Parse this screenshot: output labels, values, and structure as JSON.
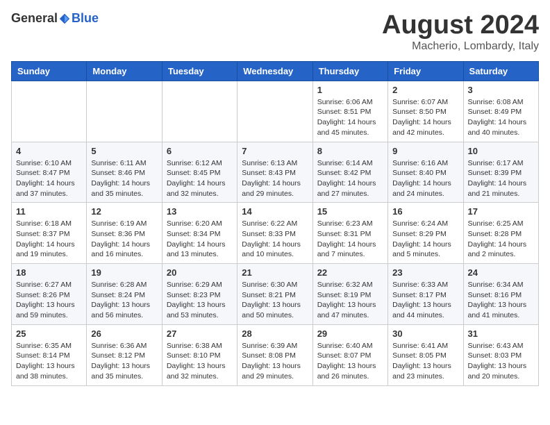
{
  "header": {
    "logo_general": "General",
    "logo_blue": "Blue",
    "month": "August 2024",
    "location": "Macherio, Lombardy, Italy"
  },
  "weekdays": [
    "Sunday",
    "Monday",
    "Tuesday",
    "Wednesday",
    "Thursday",
    "Friday",
    "Saturday"
  ],
  "weeks": [
    [
      {
        "day": "",
        "info": ""
      },
      {
        "day": "",
        "info": ""
      },
      {
        "day": "",
        "info": ""
      },
      {
        "day": "",
        "info": ""
      },
      {
        "day": "1",
        "info": "Sunrise: 6:06 AM\nSunset: 8:51 PM\nDaylight: 14 hours\nand 45 minutes."
      },
      {
        "day": "2",
        "info": "Sunrise: 6:07 AM\nSunset: 8:50 PM\nDaylight: 14 hours\nand 42 minutes."
      },
      {
        "day": "3",
        "info": "Sunrise: 6:08 AM\nSunset: 8:49 PM\nDaylight: 14 hours\nand 40 minutes."
      }
    ],
    [
      {
        "day": "4",
        "info": "Sunrise: 6:10 AM\nSunset: 8:47 PM\nDaylight: 14 hours\nand 37 minutes."
      },
      {
        "day": "5",
        "info": "Sunrise: 6:11 AM\nSunset: 8:46 PM\nDaylight: 14 hours\nand 35 minutes."
      },
      {
        "day": "6",
        "info": "Sunrise: 6:12 AM\nSunset: 8:45 PM\nDaylight: 14 hours\nand 32 minutes."
      },
      {
        "day": "7",
        "info": "Sunrise: 6:13 AM\nSunset: 8:43 PM\nDaylight: 14 hours\nand 29 minutes."
      },
      {
        "day": "8",
        "info": "Sunrise: 6:14 AM\nSunset: 8:42 PM\nDaylight: 14 hours\nand 27 minutes."
      },
      {
        "day": "9",
        "info": "Sunrise: 6:16 AM\nSunset: 8:40 PM\nDaylight: 14 hours\nand 24 minutes."
      },
      {
        "day": "10",
        "info": "Sunrise: 6:17 AM\nSunset: 8:39 PM\nDaylight: 14 hours\nand 21 minutes."
      }
    ],
    [
      {
        "day": "11",
        "info": "Sunrise: 6:18 AM\nSunset: 8:37 PM\nDaylight: 14 hours\nand 19 minutes."
      },
      {
        "day": "12",
        "info": "Sunrise: 6:19 AM\nSunset: 8:36 PM\nDaylight: 14 hours\nand 16 minutes."
      },
      {
        "day": "13",
        "info": "Sunrise: 6:20 AM\nSunset: 8:34 PM\nDaylight: 14 hours\nand 13 minutes."
      },
      {
        "day": "14",
        "info": "Sunrise: 6:22 AM\nSunset: 8:33 PM\nDaylight: 14 hours\nand 10 minutes."
      },
      {
        "day": "15",
        "info": "Sunrise: 6:23 AM\nSunset: 8:31 PM\nDaylight: 14 hours\nand 7 minutes."
      },
      {
        "day": "16",
        "info": "Sunrise: 6:24 AM\nSunset: 8:29 PM\nDaylight: 14 hours\nand 5 minutes."
      },
      {
        "day": "17",
        "info": "Sunrise: 6:25 AM\nSunset: 8:28 PM\nDaylight: 14 hours\nand 2 minutes."
      }
    ],
    [
      {
        "day": "18",
        "info": "Sunrise: 6:27 AM\nSunset: 8:26 PM\nDaylight: 13 hours\nand 59 minutes."
      },
      {
        "day": "19",
        "info": "Sunrise: 6:28 AM\nSunset: 8:24 PM\nDaylight: 13 hours\nand 56 minutes."
      },
      {
        "day": "20",
        "info": "Sunrise: 6:29 AM\nSunset: 8:23 PM\nDaylight: 13 hours\nand 53 minutes."
      },
      {
        "day": "21",
        "info": "Sunrise: 6:30 AM\nSunset: 8:21 PM\nDaylight: 13 hours\nand 50 minutes."
      },
      {
        "day": "22",
        "info": "Sunrise: 6:32 AM\nSunset: 8:19 PM\nDaylight: 13 hours\nand 47 minutes."
      },
      {
        "day": "23",
        "info": "Sunrise: 6:33 AM\nSunset: 8:17 PM\nDaylight: 13 hours\nand 44 minutes."
      },
      {
        "day": "24",
        "info": "Sunrise: 6:34 AM\nSunset: 8:16 PM\nDaylight: 13 hours\nand 41 minutes."
      }
    ],
    [
      {
        "day": "25",
        "info": "Sunrise: 6:35 AM\nSunset: 8:14 PM\nDaylight: 13 hours\nand 38 minutes."
      },
      {
        "day": "26",
        "info": "Sunrise: 6:36 AM\nSunset: 8:12 PM\nDaylight: 13 hours\nand 35 minutes."
      },
      {
        "day": "27",
        "info": "Sunrise: 6:38 AM\nSunset: 8:10 PM\nDaylight: 13 hours\nand 32 minutes."
      },
      {
        "day": "28",
        "info": "Sunrise: 6:39 AM\nSunset: 8:08 PM\nDaylight: 13 hours\nand 29 minutes."
      },
      {
        "day": "29",
        "info": "Sunrise: 6:40 AM\nSunset: 8:07 PM\nDaylight: 13 hours\nand 26 minutes."
      },
      {
        "day": "30",
        "info": "Sunrise: 6:41 AM\nSunset: 8:05 PM\nDaylight: 13 hours\nand 23 minutes."
      },
      {
        "day": "31",
        "info": "Sunrise: 6:43 AM\nSunset: 8:03 PM\nDaylight: 13 hours\nand 20 minutes."
      }
    ]
  ]
}
